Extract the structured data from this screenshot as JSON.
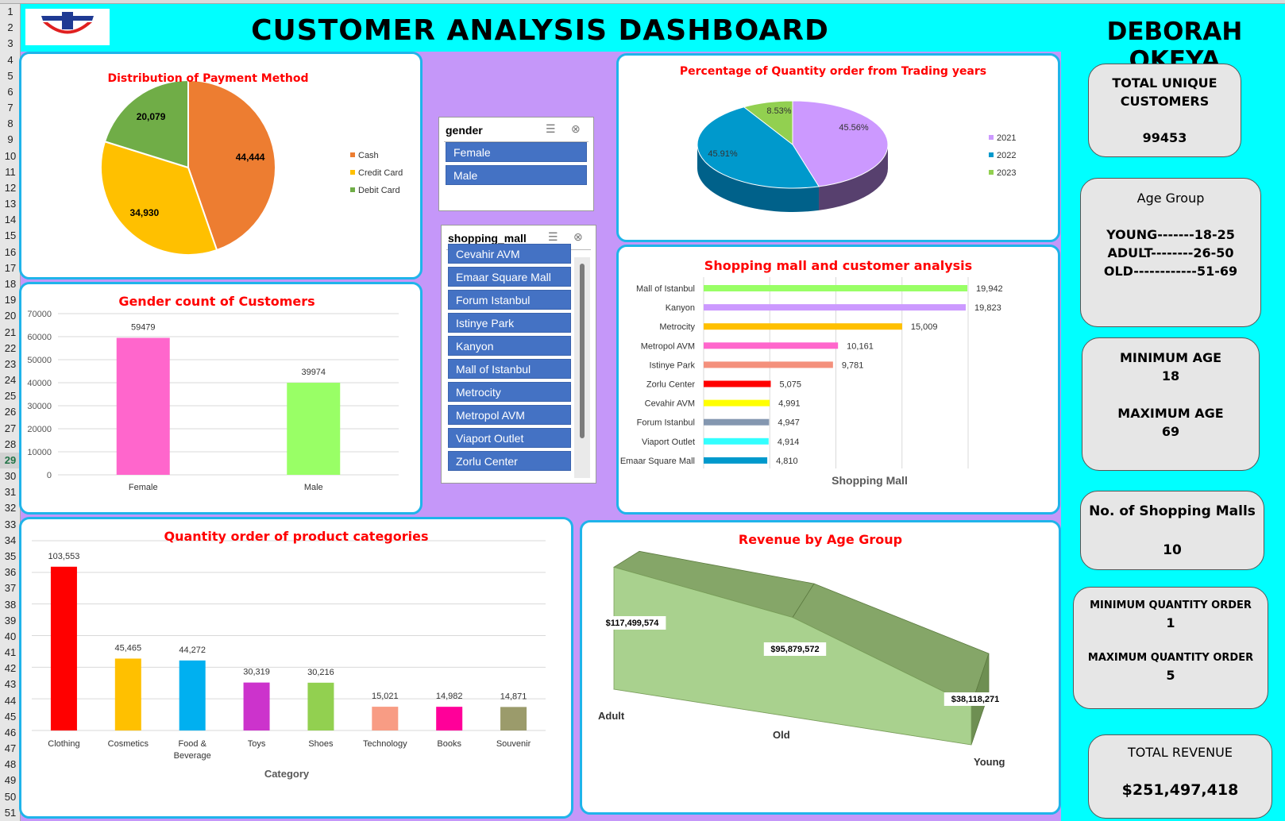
{
  "header": {
    "title": "CUSTOMER ANALYSIS DASHBOARD",
    "author": "DEBORAH OKEYA"
  },
  "row_numbers": [
    "1",
    "2",
    "3",
    "4",
    "5",
    "6",
    "7",
    "8",
    "9",
    "10",
    "11",
    "12",
    "13",
    "14",
    "15",
    "16",
    "17",
    "18",
    "19",
    "20",
    "21",
    "22",
    "23",
    "24",
    "25",
    "26",
    "27",
    "28",
    "29",
    "30",
    "31",
    "32",
    "33",
    "34",
    "35",
    "36",
    "37",
    "38",
    "39",
    "40",
    "41",
    "42",
    "43",
    "44",
    "45",
    "46",
    "47",
    "48",
    "49",
    "50",
    "51"
  ],
  "selected_row": "29",
  "colors": {
    "panel_border": "#1fb4ea",
    "title_red": "#ff0000",
    "slicer_button": "#4472c4",
    "dashboard_bg": "#00ffff",
    "chart_area_bg": "#c597f9"
  },
  "slicers": {
    "gender": {
      "header": "gender",
      "items": [
        "Female",
        "Male"
      ]
    },
    "mall": {
      "header": "shopping_mall",
      "items": [
        "Cevahir AVM",
        "Emaar Square Mall",
        "Forum Istanbul",
        "Istinye Park",
        "Kanyon",
        "Mall of Istanbul",
        "Metrocity",
        "Metropol AVM",
        "Viaport Outlet",
        "Zorlu Center"
      ]
    }
  },
  "cards": {
    "unique_customers": {
      "label1": "TOTAL UNIQUE",
      "label2": "CUSTOMERS",
      "value": "99453"
    },
    "age_group": {
      "title": "Age Group",
      "young": "YOUNG-------18-25",
      "adult": "ADULT--------26-50",
      "old": "OLD------------51-69"
    },
    "age_range": {
      "min_label": "MINIMUM AGE",
      "min_value": "18",
      "max_label": "MAXIMUM AGE",
      "max_value": "69"
    },
    "malls": {
      "label": "No. of Shopping Malls",
      "value": "10"
    },
    "quantity": {
      "min_label": "MINIMUM QUANTITY ORDER",
      "min_value": "1",
      "max_label": "MAXIMUM QUANTITY ORDER",
      "max_value": "5"
    },
    "revenue": {
      "label": "TOTAL REVENUE",
      "value": "$251,497,418"
    }
  },
  "chart_data": [
    {
      "id": "payment",
      "type": "pie",
      "title": "Distribution of Payment Method",
      "categories": [
        "Cash",
        "Credit Card",
        "Debit Card"
      ],
      "values": [
        44444,
        34930,
        20079
      ],
      "labels": [
        "44,444",
        "34,930",
        "20,079"
      ],
      "colors": [
        "#ed7d31",
        "#ffc000",
        "#70ad47"
      ],
      "legend": "right"
    },
    {
      "id": "gender",
      "type": "bar",
      "title": "Gender count of Customers",
      "categories": [
        "Female",
        "Male"
      ],
      "values": [
        59479,
        39974
      ],
      "labels": [
        "59479",
        "39974"
      ],
      "colors": [
        "#ff66cc",
        "#99ff66"
      ],
      "ylim": [
        0,
        70000
      ],
      "yticks": [
        "0",
        "10000",
        "20000",
        "30000",
        "40000",
        "50000",
        "60000",
        "70000"
      ],
      "grid": true
    },
    {
      "id": "years",
      "type": "pie",
      "title": "Percentage of Quantity order from Trading years",
      "categories": [
        "2021",
        "2022",
        "2023"
      ],
      "values": [
        45.56,
        45.91,
        8.53
      ],
      "labels": [
        "45.56%",
        "45.91%",
        "8.53%"
      ],
      "colors": [
        "#cc99ff",
        "#0099cc",
        "#92d050"
      ],
      "legend": "right"
    },
    {
      "id": "malls",
      "type": "bar",
      "orientation": "horizontal",
      "title": "Shopping mall and customer analysis",
      "xlabel": "Shopping Mall",
      "categories": [
        "Mall of Istanbul",
        "Kanyon",
        "Metrocity",
        "Metropol AVM",
        "Istinye Park",
        "Zorlu Center",
        "Cevahir AVM",
        "Forum Istanbul",
        "Viaport Outlet",
        "Emaar Square Mall"
      ],
      "values": [
        19942,
        19823,
        15009,
        10161,
        9781,
        5075,
        4991,
        4947,
        4914,
        4810
      ],
      "labels": [
        "19,942",
        "19,823",
        "15,009",
        "10,161",
        "9,781",
        "5,075",
        "4,991",
        "4,947",
        "4,914",
        "4,810"
      ],
      "colors": [
        "#99ff66",
        "#cc99ff",
        "#ffc000",
        "#ff66cc",
        "#f4907c",
        "#ff0000",
        "#ffff00",
        "#8497b0",
        "#33ffff",
        "#0099cc"
      ],
      "xlim": [
        0,
        20000
      ],
      "grid": true
    },
    {
      "id": "categories",
      "type": "bar",
      "title": "Quantity order of product categories",
      "xlabel": "Category",
      "categories": [
        "Clothing",
        "Cosmetics",
        "Food & Beverage",
        "Toys",
        "Shoes",
        "Technology",
        "Books",
        "Souvenir"
      ],
      "tick_lines": [
        [
          "Clothing"
        ],
        [
          "Cosmetics"
        ],
        [
          "Food &",
          "Beverage"
        ],
        [
          "Toys"
        ],
        [
          "Shoes"
        ],
        [
          "Technology"
        ],
        [
          "Books"
        ],
        [
          "Souvenir"
        ]
      ],
      "values": [
        103553,
        45465,
        44272,
        30319,
        30216,
        15021,
        14982,
        14871
      ],
      "labels": [
        "103,553",
        "45,465",
        "44,272",
        "30,319",
        "30,216",
        "15,021",
        "14,982",
        "14,871"
      ],
      "colors": [
        "#ff0000",
        "#ffc000",
        "#00b0f0",
        "#cc33cc",
        "#92d050",
        "#f89c84",
        "#ff0099",
        "#9b9b6b"
      ],
      "ylim": [
        0,
        120000
      ],
      "grid": true
    },
    {
      "id": "revenue",
      "type": "area",
      "title": "Revenue by Age Group",
      "categories": [
        "Adult",
        "Old",
        "Young"
      ],
      "values": [
        117499574,
        95879572,
        38118271
      ],
      "labels": [
        "$117,499,574",
        "$95,879,572",
        "$38,118,271"
      ],
      "colors": [
        "#a9d18e",
        "#85a668",
        "#6e8f52"
      ],
      "ylim": [
        0,
        130000000
      ]
    }
  ]
}
